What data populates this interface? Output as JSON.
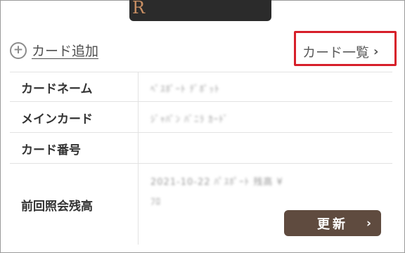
{
  "header": {
    "card_mark": "R"
  },
  "actions": {
    "add_card_label": "カード追加",
    "card_list_label": "カード一覧"
  },
  "details": {
    "rows": [
      {
        "label": "カードネーム",
        "value": "ﾍﾟｽﾎﾟｰﾄ          ﾃﾞﾎﾟｯﾄ"
      },
      {
        "label": "メインカード",
        "value": "ｼﾞｬﾊﾟﾝ ﾊﾞﾆﾗ ｶｰﾄﾞ"
      },
      {
        "label": "カード番号",
        "value": ""
      },
      {
        "label": "前回照会残高",
        "value": "2021-10-22 ﾊﾟｽﾎﾟｰﾄ 残高 ¥"
      }
    ],
    "value_extra": "ﾌﾛ"
  },
  "update_button": {
    "label": "更新",
    "chevron": "›"
  },
  "colors": {
    "highlight_box": "#d71f2a",
    "button_bg": "#5f4b3f",
    "card_bg": "#2b2b2b"
  }
}
